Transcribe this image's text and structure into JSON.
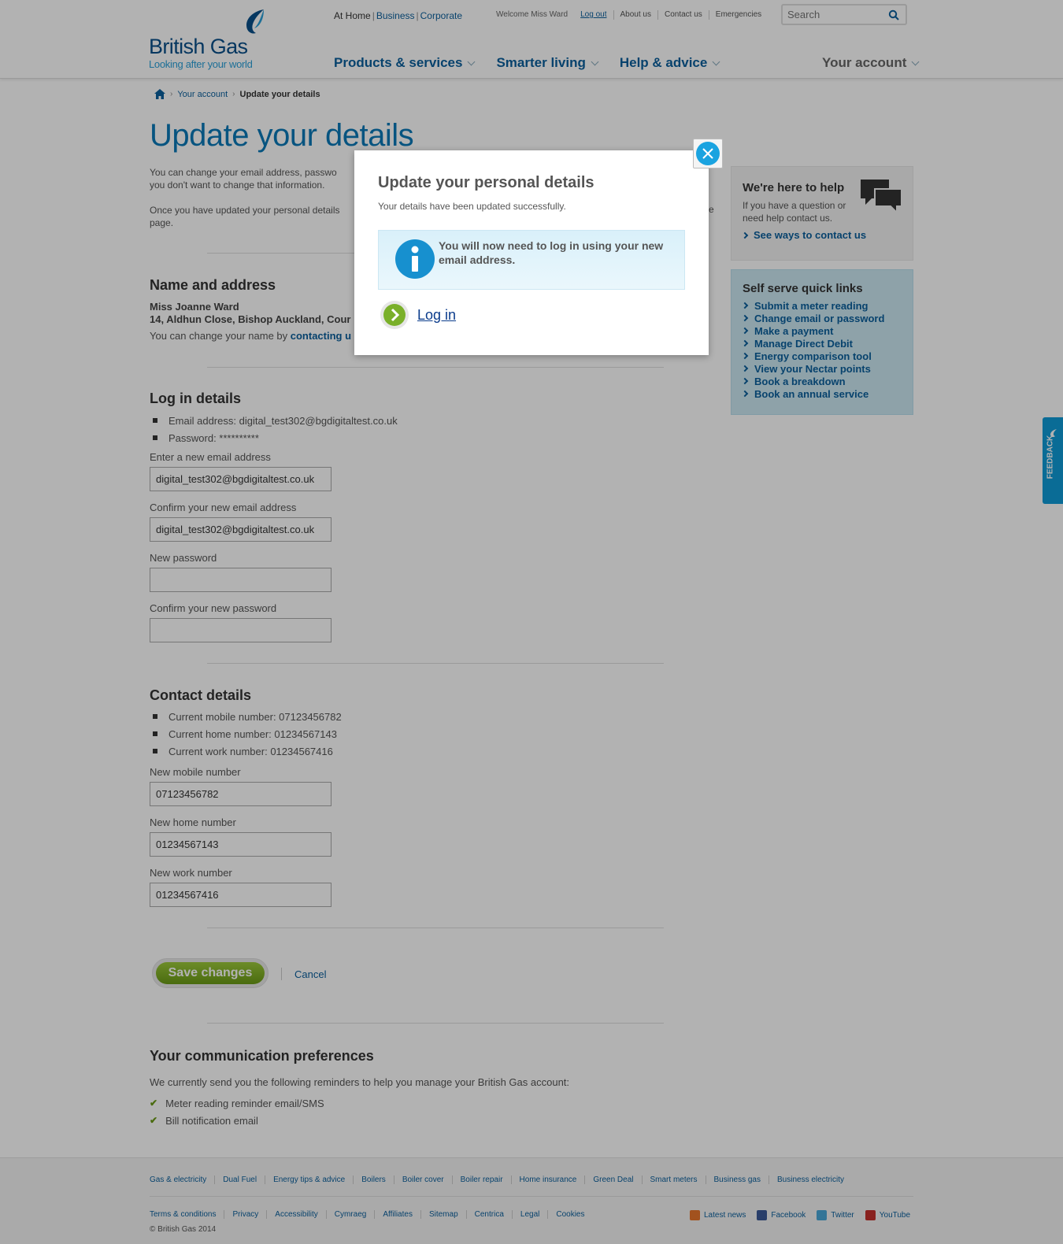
{
  "header": {
    "logo_name": "British Gas",
    "logo_tagline": "Looking after your world",
    "segments": {
      "active": "At Home",
      "business": "Business",
      "corporate": "Corporate"
    },
    "welcome": "Welcome Miss Ward",
    "logout": "Log out",
    "util_links": [
      "About us",
      "Contact us",
      "Emergencies"
    ],
    "search_placeholder": "Search",
    "nav": [
      "Products & services",
      "Smarter living",
      "Help & advice"
    ],
    "account": "Your account"
  },
  "breadcrumb": {
    "parent": "Your account",
    "current": "Update your details"
  },
  "page": {
    "title": "Update your details",
    "intro1_line1": "You can change your email address, passwo",
    "intro1_line2": "you don't want to change that information.",
    "intro2_line1": "Once you have updated your personal details",
    "intro2_line2": "page.",
    "intro2_tail": "e"
  },
  "name_address": {
    "heading": "Name and address",
    "name": "Miss Joanne Ward",
    "address": "14, Aldhun Close, Bishop Auckland, Cour",
    "note_prefix": "You can change your name by ",
    "note_link": "contacting u"
  },
  "login_details": {
    "heading": "Log in details",
    "email_current": "Email address: digital_test302@bgdigitaltest.co.uk",
    "password_current": "Password: **********",
    "new_email_label": "Enter a new email address",
    "new_email_value": "digital_test302@bgdigitaltest.co.uk",
    "confirm_email_label": "Confirm your new email address",
    "confirm_email_value": "digital_test302@bgdigitaltest.co.uk",
    "new_password_label": "New password",
    "confirm_password_label": "Confirm your new password"
  },
  "contact_details": {
    "heading": "Contact details",
    "current_mobile": "Current mobile number: 07123456782",
    "current_home": "Current home number: 01234567143",
    "current_work": "Current work number: 01234567416",
    "mobile_label": "New mobile number",
    "mobile_value": "07123456782",
    "home_label": "New home number",
    "home_value": "01234567143",
    "work_label": "New work number",
    "work_value": "01234567416"
  },
  "actions": {
    "save": "Save changes",
    "cancel": "Cancel"
  },
  "communication": {
    "heading": "Your communication preferences",
    "text": "We currently send you the following reminders to help you manage your British Gas account:",
    "items": [
      "Meter reading reminder email/SMS",
      "Bill notification email"
    ]
  },
  "sidebar": {
    "help_title": "We're here to help",
    "help_text": "If you have a question or need help contact us.",
    "help_link": "See ways to contact us",
    "quick_title": "Self serve quick links",
    "quick_links": [
      "Submit a meter reading",
      "Change email or password",
      "Make a payment",
      "Manage Direct Debit",
      "Energy comparison tool",
      "View your Nectar points",
      "Book a breakdown",
      "Book an annual service"
    ],
    "feedback": "FEEDBACK"
  },
  "footer": {
    "links": [
      "Gas & electricity",
      "Dual Fuel",
      "Energy tips & advice",
      "Boilers",
      "Boiler cover",
      "Boiler repair",
      "Home insurance",
      "Green Deal",
      "Smart meters",
      "Business gas",
      "Business electricity"
    ],
    "legal": [
      "Terms & conditions",
      "Privacy",
      "Accessibility",
      "Cymraeg",
      "Affiliates",
      "Sitemap",
      "Centrica",
      "Legal",
      "Cookies"
    ],
    "copyright": "© British Gas 2014",
    "social": [
      "Latest news",
      "Facebook",
      "Twitter",
      "YouTube"
    ]
  },
  "modal": {
    "title": "Update your personal details",
    "subtitle": "Your details have been updated successfully.",
    "info": "You will now need to log in using your new email address.",
    "login": "Log in"
  },
  "colors": {
    "brand_blue": "#0b5f9c",
    "title_blue": "#0b79b8",
    "accent_green": "#7ab02a",
    "feedback_blue": "#0f9bd7"
  }
}
